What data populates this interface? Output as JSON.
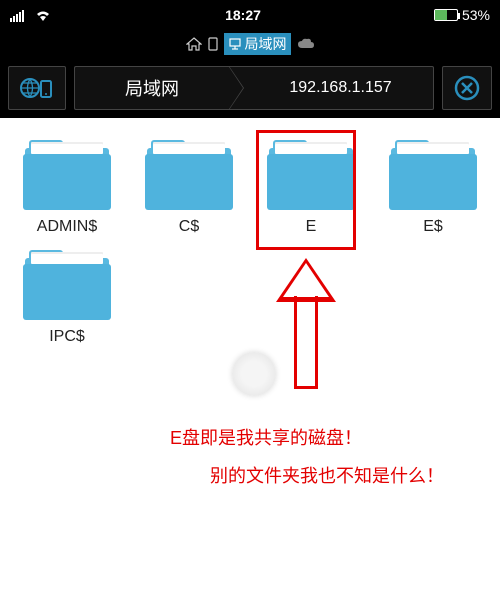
{
  "status": {
    "time": "18:27",
    "battery": "53%"
  },
  "breadcrumb": {
    "active_label": "局域网"
  },
  "nav": {
    "section": "局域网",
    "address": "192.168.1.157"
  },
  "folders": [
    {
      "label": "ADMIN$"
    },
    {
      "label": "C$"
    },
    {
      "label": "E"
    },
    {
      "label": "E$"
    },
    {
      "label": "IPC$"
    }
  ],
  "annotations": {
    "line1": "E盘即是我共享的磁盘！",
    "line2": "别的文件夹我也不知是什么！"
  }
}
